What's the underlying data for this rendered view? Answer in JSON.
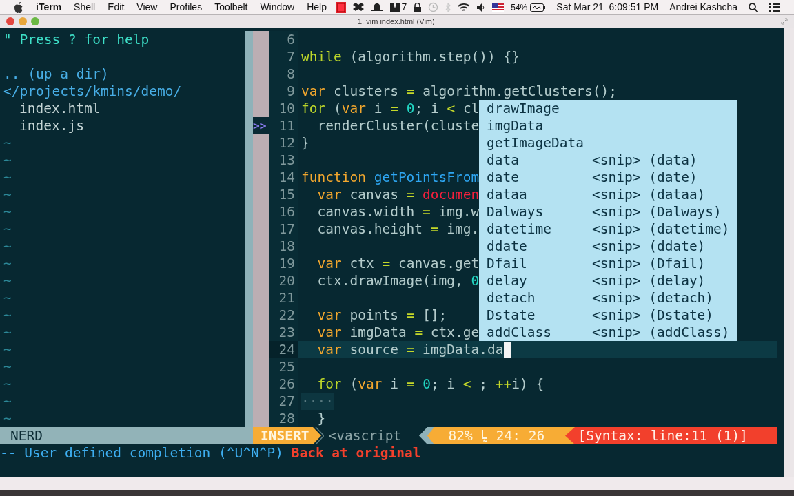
{
  "menubar": {
    "app": "iTerm",
    "items": [
      "Shell",
      "Edit",
      "View",
      "Profiles",
      "Toolbelt",
      "Window",
      "Help"
    ],
    "adobe_count": "7",
    "battery": "54%",
    "clock": "Sat Mar 21  6:09:51 PM",
    "user": "Andrei Kashcha"
  },
  "window": {
    "title": "1. vim index.html (Vim)"
  },
  "nerdtree": {
    "help": "\" Press ? for help",
    "up": ".. (up a dir)",
    "root": "</projects/kmins/demo/",
    "files": [
      "index.html",
      "index.js"
    ],
    "filler": [
      "~",
      "~",
      "~",
      "~",
      "~",
      "~",
      "~",
      "~",
      "~",
      "~",
      "~",
      "~",
      "~",
      "~",
      "~",
      "~",
      "~"
    ]
  },
  "editor": {
    "lines": [
      {
        "number": "6",
        "current": false
      },
      {
        "number": "7",
        "current": false,
        "segments": [
          {
            "text": "while",
            "kind": "control"
          },
          {
            "text": " (algorithm.step()) {}",
            "kind": "plain"
          }
        ]
      },
      {
        "number": "8",
        "current": false
      },
      {
        "number": "9",
        "current": false,
        "segments": [
          {
            "text": "var",
            "kind": "keyword"
          },
          {
            "text": " clusters ",
            "kind": "plain"
          },
          {
            "text": "=",
            "kind": "operator"
          },
          {
            "text": " algorithm.getClusters();",
            "kind": "plain"
          }
        ]
      },
      {
        "number": "10",
        "current": false,
        "segments": [
          {
            "text": "for",
            "kind": "control"
          },
          {
            "text": " (",
            "kind": "plain"
          },
          {
            "text": "var",
            "kind": "keyword"
          },
          {
            "text": " i ",
            "kind": "plain"
          },
          {
            "text": "=",
            "kind": "operator"
          },
          {
            "text": " 0",
            "kind": "number"
          },
          {
            "text": "; i ",
            "kind": "plain"
          },
          {
            "text": "<",
            "kind": "operator"
          },
          {
            "text": " cl",
            "kind": "plain"
          }
        ]
      },
      {
        "number": "11",
        "current": false,
        "sign": ">>",
        "segments": [
          {
            "text": "  renderCluster(cluste",
            "kind": "plain"
          }
        ]
      },
      {
        "number": "12",
        "current": false,
        "segments": [
          {
            "text": "}",
            "kind": "plain"
          }
        ]
      },
      {
        "number": "13",
        "current": false
      },
      {
        "number": "14",
        "current": false,
        "segments": [
          {
            "text": "function",
            "kind": "keyword"
          },
          {
            "text": " getPointsFrom",
            "kind": "function"
          }
        ]
      },
      {
        "number": "15",
        "current": false,
        "segments": [
          {
            "text": "  var",
            "kind": "keyword"
          },
          {
            "text": " canvas ",
            "kind": "plain"
          },
          {
            "text": "=",
            "kind": "operator"
          },
          {
            "text": " documen",
            "kind": "builtin"
          }
        ]
      },
      {
        "number": "16",
        "current": false,
        "segments": [
          {
            "text": "  canvas.width ",
            "kind": "plain"
          },
          {
            "text": "=",
            "kind": "operator"
          },
          {
            "text": " img.w",
            "kind": "plain"
          }
        ]
      },
      {
        "number": "17",
        "current": false,
        "segments": [
          {
            "text": "  canvas.height ",
            "kind": "plain"
          },
          {
            "text": "=",
            "kind": "operator"
          },
          {
            "text": " img.",
            "kind": "plain"
          }
        ]
      },
      {
        "number": "18",
        "current": false
      },
      {
        "number": "19",
        "current": false,
        "segments": [
          {
            "text": "  var",
            "kind": "keyword"
          },
          {
            "text": " ctx ",
            "kind": "plain"
          },
          {
            "text": "=",
            "kind": "operator"
          },
          {
            "text": " canvas.get",
            "kind": "plain"
          }
        ]
      },
      {
        "number": "20",
        "current": false,
        "segments": [
          {
            "text": "  ctx.drawImage(img, ",
            "kind": "plain"
          },
          {
            "text": "0",
            "kind": "number"
          }
        ]
      },
      {
        "number": "21",
        "current": false
      },
      {
        "number": "22",
        "current": false,
        "segments": [
          {
            "text": "  var",
            "kind": "keyword"
          },
          {
            "text": " points ",
            "kind": "plain"
          },
          {
            "text": "=",
            "kind": "operator"
          },
          {
            "text": " [];",
            "kind": "plain"
          }
        ]
      },
      {
        "number": "23",
        "current": false,
        "segments": [
          {
            "text": "  var",
            "kind": "keyword"
          },
          {
            "text": " imgData ",
            "kind": "plain"
          },
          {
            "text": "=",
            "kind": "operator"
          },
          {
            "text": " ctx.ge",
            "kind": "plain"
          }
        ]
      },
      {
        "number": "24",
        "current": true,
        "segments": [
          {
            "text": "  var",
            "kind": "keyword"
          },
          {
            "text": " source ",
            "kind": "plain"
          },
          {
            "text": "=",
            "kind": "operator"
          },
          {
            "text": " imgData.da",
            "kind": "plain"
          }
        ]
      },
      {
        "number": "25",
        "current": false
      },
      {
        "number": "26",
        "current": false,
        "segments": [
          {
            "text": "  for",
            "kind": "control"
          },
          {
            "text": " (",
            "kind": "plain"
          },
          {
            "text": "var",
            "kind": "keyword"
          },
          {
            "text": " i ",
            "kind": "plain"
          },
          {
            "text": "=",
            "kind": "operator"
          },
          {
            "text": " 0",
            "kind": "number"
          },
          {
            "text": "; i ",
            "kind": "plain"
          },
          {
            "text": "<",
            "kind": "operator"
          },
          {
            "text": " ; ",
            "kind": "plain"
          },
          {
            "text": "++",
            "kind": "operator"
          },
          {
            "text": "i) {",
            "kind": "plain"
          }
        ]
      },
      {
        "number": "27",
        "current": false,
        "segments": [
          {
            "text": "····",
            "kind": "whitespace"
          }
        ]
      },
      {
        "number": "28",
        "current": false,
        "segments": [
          {
            "text": "  }",
            "kind": "plain"
          }
        ]
      }
    ]
  },
  "completion": [
    {
      "word": "drawImage"
    },
    {
      "word": "imgData"
    },
    {
      "word": "getImageData"
    },
    {
      "word": "data",
      "menu": "<snip> (data)"
    },
    {
      "word": "date",
      "menu": "<snip> (date)"
    },
    {
      "word": "dataa",
      "menu": "<snip> (dataa)"
    },
    {
      "word": "Dalways",
      "menu": "<snip> (Dalways)"
    },
    {
      "word": "datetime",
      "menu": "<snip> (datetime)"
    },
    {
      "word": "ddate",
      "menu": "<snip> (ddate)"
    },
    {
      "word": "Dfail",
      "menu": "<snip> (Dfail)"
    },
    {
      "word": "delay",
      "menu": "<snip> (delay)"
    },
    {
      "word": "detach",
      "menu": "<snip> (detach)"
    },
    {
      "word": "Dstate",
      "menu": "<snip> (Dstate)"
    },
    {
      "word": "addClass",
      "menu": "<snip> (addClass)"
    }
  ],
  "statusline": {
    "tree": "NERD",
    "mode": "INSERT",
    "filetype": "<vascript",
    "percent": "82%",
    "position": "24: 26",
    "syntax": "[Syntax: line:11 (1)]"
  },
  "cmdline": {
    "message": "-- User defined completion (^U^N^P)",
    "error": "Back at original"
  }
}
